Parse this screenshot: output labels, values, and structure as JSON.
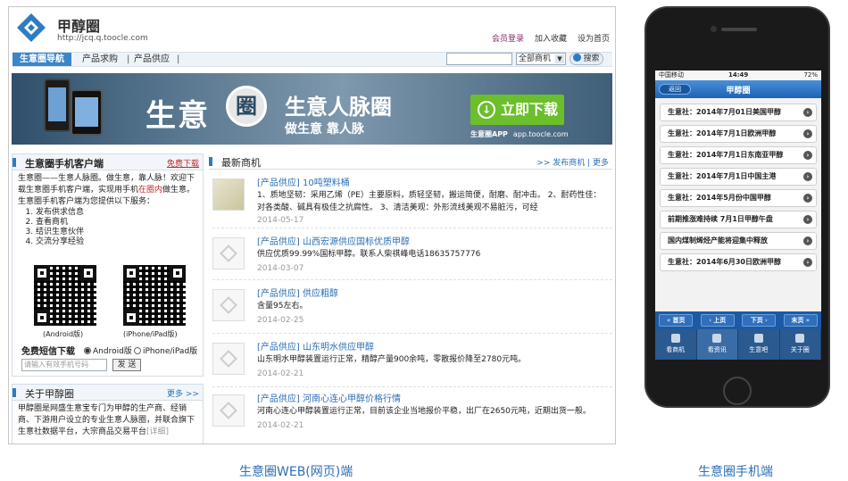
{
  "web": {
    "logo_title": "甲醇圈",
    "logo_url": "http://jcq.q.toocle.com",
    "toplinks": [
      "会员登录",
      "加入收藏",
      "设为首页"
    ],
    "nav": {
      "active": "生意圈导航",
      "items": [
        "产品求购",
        "产品供应"
      ],
      "sep": "|"
    },
    "search": {
      "select_value": "全部商机",
      "button": "搜索"
    },
    "banner": {
      "big": "生意",
      "circle": "圈",
      "title": "生意人脉圈",
      "subtitle": "做生意 靠人脉",
      "download": "立即下载",
      "app_label": "生意圈APP",
      "app_url": "app.toocle.com"
    },
    "client_box": {
      "title": "生意圈手机客户端",
      "free_download": "免费下载",
      "intro_a": "生意圈——生意人脉圈。做生意，靠人脉！欢迎下载生意圈手机客户端，实现用手机",
      "intro_red": "在圈内",
      "intro_b": "做生意。生意圈手机客户端为您提供以下服务：",
      "services": [
        "发布供求信息",
        "查看商机",
        "结识生意伙伴",
        "交流分享经验"
      ],
      "qr_android": "(Android版)",
      "qr_iphone": "(iPhone/iPad版)",
      "sms_title": "免费短信下载",
      "radio_android": "Android版",
      "radio_iphone": "iPhone/iPad版",
      "sms_placeholder": "请输入有效手机号码",
      "sms_button": "发 送"
    },
    "about_box": {
      "title": "关于甲醇圈",
      "more": "更多 >>",
      "text": "甲醇圈是网盛生意宝专门为甲醇的生产商、经销商、下游用户设立的专业生意人脉圈，并联合旗下生意社数据平台，大宗商品交易平台",
      "detail": "[详细]"
    },
    "news": {
      "title": "最新商机",
      "links": ">> 发布商机 | 更多",
      "items": [
        {
          "title": "[产品供应] 10吨塑料桶",
          "desc": "1、质地坚韧：采用乙烯（PE）主要原料，质轻坚韧，搬运简便，耐磨、耐冲击。 2、耐药性佳：对各类酸、碱具有极佳之抗腐性。 3、清洁美观：外形流线美观不易脏污，可经",
          "date": "2014-05-17"
        },
        {
          "title": "[产品供应] 山西宏源供应国标优质甲醇",
          "desc": "供应优质99.99%国标甲醇。联系人柴祺峰电话18635757776",
          "date": "2014-03-07"
        },
        {
          "title": "[产品供应] 供应粗醇",
          "desc": "含量95左右。",
          "date": "2014-02-25"
        },
        {
          "title": "[产品供应] 山东明水供应甲醇",
          "desc": "山东明水甲醇装置运行正常，精醇产量900余吨，零散报价降至2780元吨。",
          "date": "2014-02-21"
        },
        {
          "title": "[产品供应] 河南心连心甲醇价格行情",
          "desc": "河南心连心甲醇装置运行正常，目前该企业当地报价平稳，出厂在2650元吨，近期出货一般。",
          "date": "2014-02-21"
        }
      ]
    },
    "caption": "生意圈WEB(网页)端"
  },
  "phone": {
    "carrier": "中国移动",
    "time": "14:49",
    "battery": "72%",
    "back": "返回",
    "title": "甲醇圈",
    "rows": [
      "生意社：2014年7月01日美国甲醇",
      "生意社：2014年7月1日欧洲甲醇",
      "生意社：2014年7月1日东南亚甲醇",
      "生意社：2014年7月1日中国主港",
      "生意社：2014年5月份中国甲醇",
      "前期推涨难持续 7月1日甲醇午盘",
      "国内煤制烯烃产能将迎集中释放",
      "生意社：2014年6月30日欧洲甲醇"
    ],
    "pager": [
      "首页",
      "上页",
      "下页",
      "末页"
    ],
    "tabs": [
      "看商机",
      "看资讯",
      "生意吧",
      "关于圈"
    ],
    "caption": "生意圈手机端"
  },
  "colors": {
    "accent": "#2d7cc4",
    "download_green": "#6bbf2a",
    "link_red": "#c0282d"
  }
}
